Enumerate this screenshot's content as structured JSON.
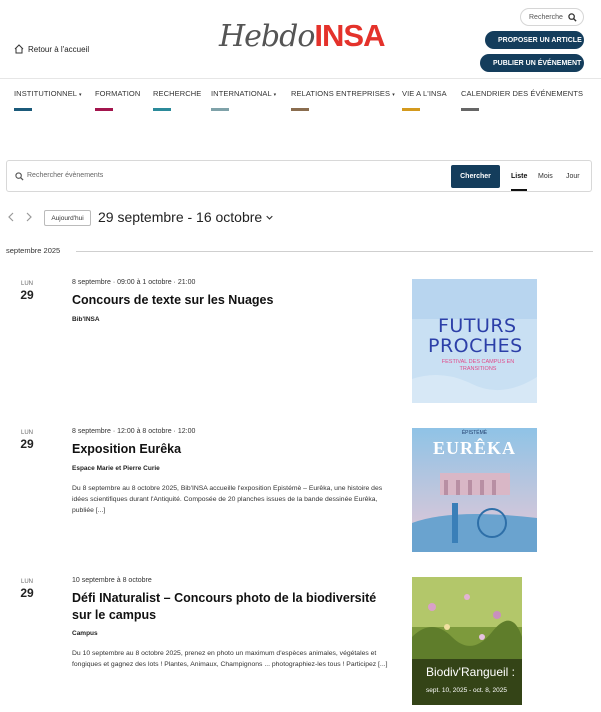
{
  "header": {
    "home_label": "Retour à l'accueil",
    "logo_part1": "Hebdo",
    "logo_part2": "INSA",
    "search_label": "Recherche",
    "propose_article": "PROPOSER UN ARTICLE",
    "publish_event": "PUBLIER UN ÉVÉNEMENT"
  },
  "nav": {
    "items": [
      {
        "label": "INSTITUTIONNEL",
        "color": "#1b5a7a"
      },
      {
        "label": "FORMATION",
        "color": "#a3154d"
      },
      {
        "label": "RECHERCHE",
        "color": "#2b8a9a"
      },
      {
        "label": "INTERNATIONAL",
        "color": "#7fa2a9"
      },
      {
        "label": "RELATIONS ENTREPRISES",
        "color": "#8a6d4f"
      },
      {
        "label": "VIE A L'INSA",
        "color": "#d49a1e"
      },
      {
        "label": "CALENDRIER DES ÉVÉNEMENTS",
        "color": "#666666"
      }
    ]
  },
  "event_search": {
    "placeholder": "Rechercher évènements",
    "button": "Chercher",
    "views": [
      "Liste",
      "Mois",
      "Jour"
    ]
  },
  "date_nav": {
    "today": "Aujourd'hui",
    "range": "29 septembre - 16 octobre"
  },
  "month_label": "septembre 2025",
  "events": [
    {
      "dow": "LUN",
      "day": "29",
      "when": "8 septembre · 09:00 à 1 octobre · 21:00",
      "title": "Concours de texte sur les Nuages",
      "venue": "Bib'INSA",
      "desc": "",
      "image_text_1": "FUTURS",
      "image_text_2": "PROCHES",
      "image_text_3": "FESTIVAL DES CAMPUS EN TRANSITIONS"
    },
    {
      "dow": "LUN",
      "day": "29",
      "when": "8 septembre · 12:00 à 8 octobre · 12:00",
      "title": "Exposition Eurêka",
      "venue": "Espace Marie et Pierre Curie",
      "desc": "Du 8 septembre au 8 octobre 2025, Bib'INSA accueille l'exposition Epistémè – Eurêka, une histoire des idées scientifiques durant l'Antiquité. Composée de 20 planches issues de la bande dessinée Eurêka, publiée [...]",
      "image_text_1": "ÉPISTÉMÈ",
      "image_text_2": "EURÊKA"
    },
    {
      "dow": "LUN",
      "day": "29",
      "when": "10 septembre à 8 octobre",
      "title": "Défi INaturalist – Concours photo de la biodiversité sur le campus",
      "venue": "Campus",
      "desc": "Du 10 septembre au 8 octobre 2025, prenez en photo un maximum d'espèces animales, végétales et fongiques et gagnez des lots ! Plantes, Animaux, Champignons ... photographiez-les tous ! Participez [...]",
      "image_text_1": "Biodiv'Rangueil :",
      "image_text_2": "sept. 10, 2025 - oct. 8, 2025"
    }
  ]
}
